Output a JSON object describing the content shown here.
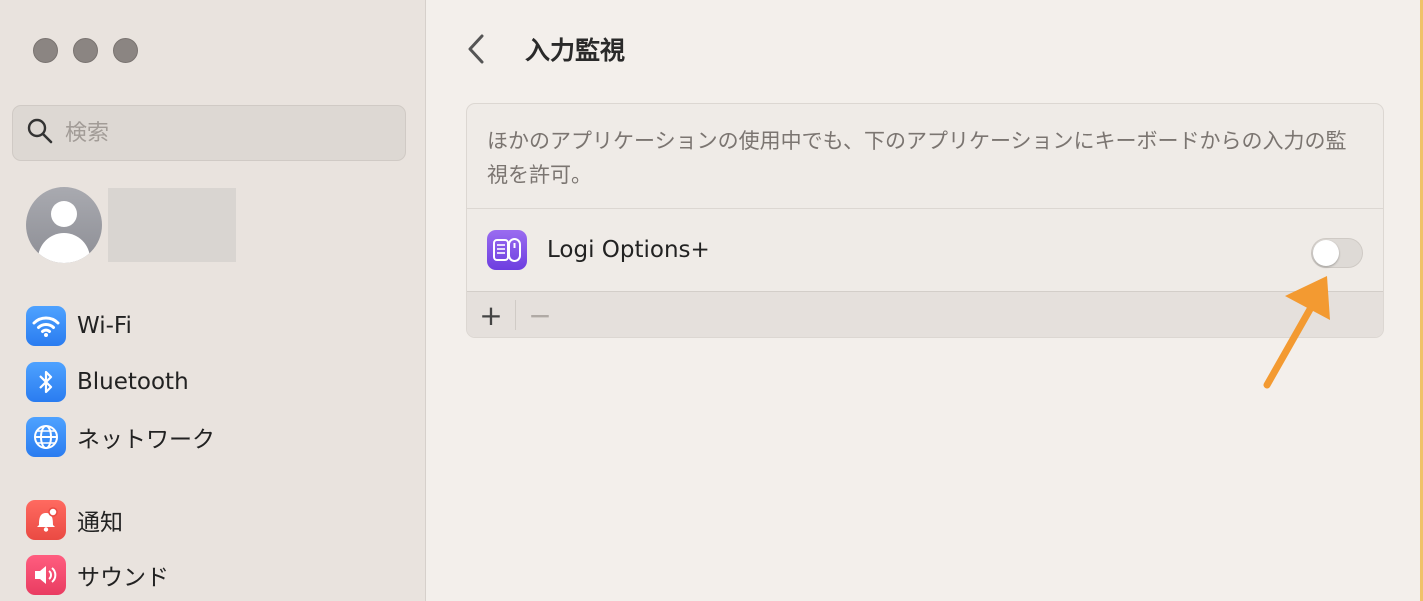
{
  "search": {
    "placeholder": "検索"
  },
  "sidebar": {
    "items": [
      {
        "label": "Wi-Fi",
        "icon": "wifi-icon"
      },
      {
        "label": "Bluetooth",
        "icon": "bluetooth-icon"
      },
      {
        "label": "ネットワーク",
        "icon": "globe-icon"
      },
      {
        "label": "通知",
        "icon": "bell-icon"
      },
      {
        "label": "サウンド",
        "icon": "speaker-icon"
      }
    ]
  },
  "header": {
    "title": "入力監視"
  },
  "main": {
    "description": "ほかのアプリケーションの使用中でも、下のアプリケーションにキーボードからの入力の監視を許可。",
    "apps": [
      {
        "name": "Logi Options+",
        "enabled": false
      }
    ],
    "toolbar": {
      "add_label": "+",
      "remove_label": "−"
    }
  },
  "colors": {
    "sidebar_bg": "#e9e3de",
    "main_bg": "#f3efeb",
    "accent_arrow": "#f39a31",
    "app_icon": "#7a4de6"
  }
}
